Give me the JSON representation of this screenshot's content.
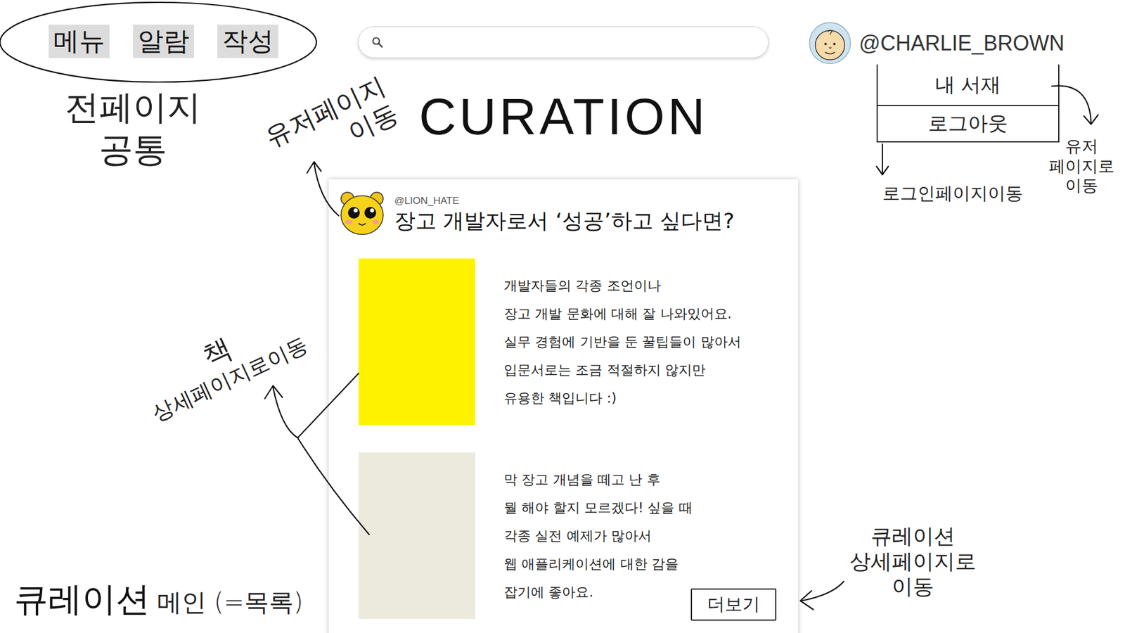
{
  "nav": {
    "buttons": [
      "메뉴",
      "알람",
      "작성"
    ]
  },
  "user": {
    "handle": "@CHARLIE_BROWN",
    "menu": [
      "내 서재",
      "로그아웃"
    ]
  },
  "page_title": "CURATION",
  "curation": {
    "author": "@LION_HATE",
    "title": "장고 개발자로서 ‘성공’하고 싶다면?",
    "books": [
      {
        "color": "#fff200",
        "description": [
          "개발자들의 각종 조언이나",
          "장고 개발 문화에 대해 잘 나와있어요.",
          "실무 경험에 기반을 둔 꿀팁들이 많아서",
          "입문서로는 조금 적절하지 않지만",
          "유용한 책입니다 :)"
        ]
      },
      {
        "color": "#ece9dd",
        "description": [
          "막 장고 개념을 떼고 난 후",
          "뭘 해야 할지 모르겠다! 싶을 때",
          "각종 실전 예제가 많아서",
          "웹 애플리케이션에 대한 감을",
          "잡기에 좋아요."
        ]
      }
    ],
    "more": "더보기"
  },
  "page_label": {
    "name": "큐레이션",
    "note": "메인 (=목록)"
  },
  "annotations": {
    "common": [
      "전페이지",
      "공통"
    ],
    "user_page": [
      "유저페이지",
      "이동"
    ],
    "book_detail": [
      "책",
      "상세페이지로이동"
    ],
    "login_page": [
      "로그인페이지이동"
    ],
    "user_page_menu": [
      "유저",
      "페이지로",
      "이동"
    ],
    "curation_detail": [
      "큐레이션",
      "상세페이지로",
      "이동"
    ]
  }
}
